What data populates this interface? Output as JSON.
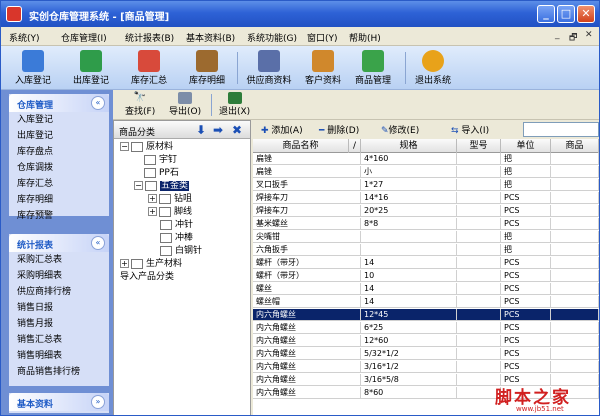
{
  "window": {
    "title": "实创仓库管理系统 - [商品管理]",
    "controls": [
      "_",
      "□",
      "✕"
    ]
  },
  "menu": {
    "items": [
      "系统(Y)",
      "仓库管理(I)",
      "统计报表(B)",
      "基本资料(B)",
      "系统功能(G)",
      "窗口(Y)",
      "帮助(H)"
    ],
    "mdi_controls": [
      "_",
      "🗗",
      "✕"
    ]
  },
  "toolbar": {
    "buttons": [
      {
        "label": "入库登记",
        "icon": "stock-in-icon",
        "color": "#3b7bd8"
      },
      {
        "label": "出库登记",
        "icon": "stock-out-icon",
        "color": "#2f9c4a"
      },
      {
        "label": "库存汇总",
        "icon": "inventory-summary-icon",
        "color": "#d84a3b"
      },
      {
        "label": "库存明细",
        "icon": "inventory-detail-icon",
        "color": "#9c6a2f"
      },
      {
        "label": "供应商资料",
        "icon": "supplier-icon",
        "color": "#5a6fa8"
      },
      {
        "label": "客户资料",
        "icon": "customer-icon",
        "color": "#d0882c"
      },
      {
        "label": "商品管理",
        "icon": "product-icon",
        "color": "#3aa34a"
      },
      {
        "label": "退出系统",
        "icon": "exit-icon",
        "color": "#e8a21a"
      }
    ]
  },
  "sidebar": {
    "groups": [
      {
        "title": "仓库管理",
        "items": [
          "入库登记",
          "出库登记",
          "库存盘点",
          "仓库调拨",
          "库存汇总",
          "库存明细",
          "库存预警"
        ]
      },
      {
        "title": "统计报表",
        "items": [
          "采购汇总表",
          "采购明细表",
          "供应商排行榜",
          "销售日报",
          "销售月报",
          "销售汇总表",
          "销售明细表",
          "商品销售排行榜"
        ]
      },
      {
        "title": "基本资料",
        "items": []
      }
    ]
  },
  "actions": {
    "find": "查找(F)",
    "export": "导出(O)",
    "exit": "退出(X)"
  },
  "tree": {
    "header": "商品分类",
    "nodes": [
      {
        "label": "原材料",
        "expander": "−"
      },
      {
        "label": "宇钉",
        "expander": ""
      },
      {
        "label": "PP石",
        "expander": ""
      },
      {
        "label": "五金类",
        "expander": "−"
      },
      {
        "label": "钻咀",
        "expander": "+"
      },
      {
        "label": "脚线",
        "expander": "+"
      },
      {
        "label": "冲针",
        "expander": ""
      },
      {
        "label": "冲棒",
        "expander": ""
      },
      {
        "label": "白钢针",
        "expander": ""
      },
      {
        "label": "生产材料",
        "expander": "+"
      },
      {
        "label": "导入产品分类",
        "expander": ""
      }
    ]
  },
  "grid": {
    "toolbar": {
      "add": "添加(A)",
      "delete": "删除(D)",
      "edit": "修改(E)",
      "import": "导入(I)"
    },
    "columns": [
      "商品名称",
      "/",
      "规格",
      "型号",
      "单位",
      "商品"
    ],
    "rows": [
      [
        "扁锉",
        "4*160",
        "",
        "把"
      ],
      [
        "扁锉",
        "小",
        "",
        "把"
      ],
      [
        "叉口扳手",
        "1*27",
        "",
        "把"
      ],
      [
        "焊接车刀",
        "14*16",
        "",
        "PCS"
      ],
      [
        "焊接车刀",
        "20*25",
        "",
        "PCS"
      ],
      [
        "基米螺丝",
        "8*8",
        "",
        "PCS"
      ],
      [
        "尖嘴钳",
        "",
        "",
        "把"
      ],
      [
        "六角扳手",
        "",
        "",
        "把"
      ],
      [
        "螺杆（带牙）",
        "14",
        "",
        "PCS"
      ],
      [
        "螺杆（带牙）",
        "10",
        "",
        "PCS"
      ],
      [
        "螺丝",
        "14",
        "",
        "PCS"
      ],
      [
        "螺丝帽",
        "14",
        "",
        "PCS"
      ],
      [
        "内六角螺丝",
        "12*45",
        "",
        "PCS"
      ],
      [
        "内六角螺丝",
        "6*25",
        "",
        "PCS"
      ],
      [
        "内六角螺丝",
        "12*60",
        "",
        "PCS"
      ],
      [
        "内六角螺丝",
        "5/32*1/2",
        "",
        "PCS"
      ],
      [
        "内六角螺丝",
        "3/16*1/2",
        "",
        "PCS"
      ],
      [
        "内六角螺丝",
        "3/16*5/8",
        "",
        "PCS"
      ],
      [
        "内六角螺丝",
        "8*60",
        "",
        ""
      ]
    ],
    "selected_row": 12
  },
  "watermark": {
    "main": "脚本之家",
    "sub": "www.jb51.net"
  }
}
